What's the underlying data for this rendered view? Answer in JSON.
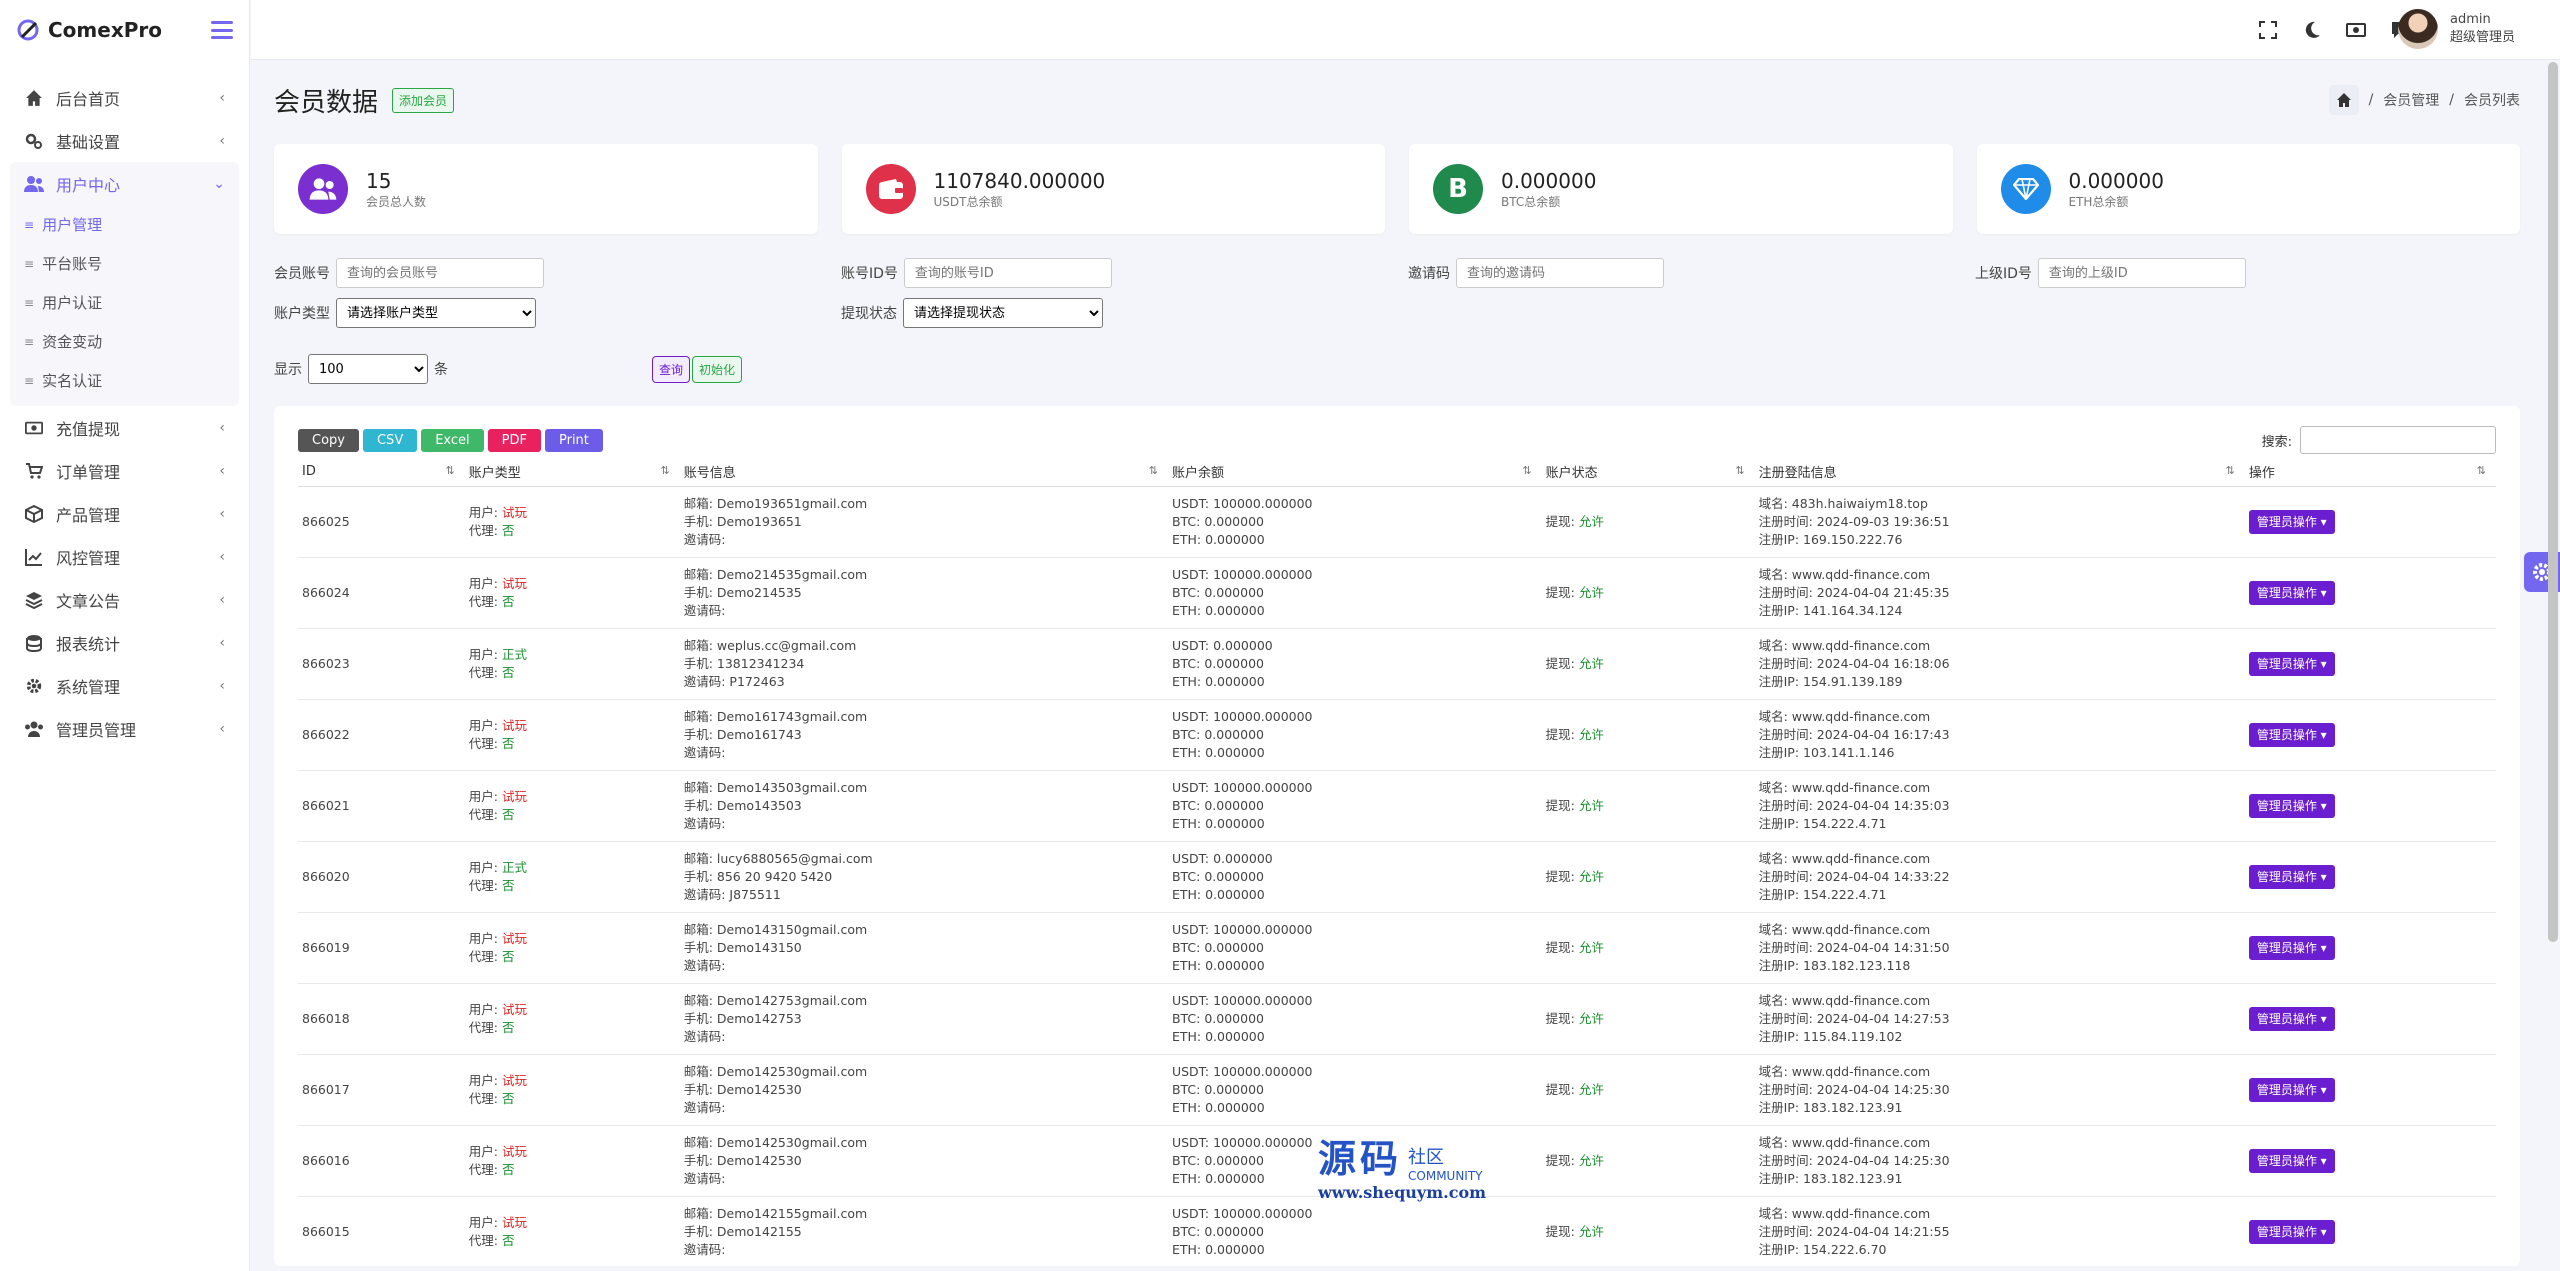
{
  "app": {
    "brand": "ComexPro"
  },
  "sidebar": {
    "items": [
      {
        "label": "后台首页",
        "icon": "home-icon"
      },
      {
        "label": "基础设置",
        "icon": "gears-icon"
      }
    ],
    "active_group": {
      "label": "用户中心",
      "icon": "users-icon",
      "children": [
        "用户管理",
        "平台账号",
        "用户认证",
        "资金变动",
        "实名认证"
      ],
      "active_child": "用户管理"
    },
    "items_after": [
      {
        "label": "充值提现",
        "icon": "money-icon"
      },
      {
        "label": "订单管理",
        "icon": "cart-icon"
      },
      {
        "label": "产品管理",
        "icon": "box-icon"
      },
      {
        "label": "风控管理",
        "icon": "chart-line-icon"
      },
      {
        "label": "文章公告",
        "icon": "layers-icon"
      },
      {
        "label": "报表统计",
        "icon": "database-icon"
      },
      {
        "label": "系统管理",
        "icon": "gear-icon"
      },
      {
        "label": "管理员管理",
        "icon": "user-group-icon"
      }
    ]
  },
  "topbar": {
    "username": "admin",
    "role": "超级管理员"
  },
  "page": {
    "title": "会员数据",
    "add_button": "添加会员",
    "breadcrumb": [
      "会员管理",
      "会员列表"
    ]
  },
  "stats": [
    {
      "value": "15",
      "label": "会员总人数",
      "color": "#7b2fd1",
      "icon": "users-icon"
    },
    {
      "value": "1107840.000000",
      "label": "USDT总余额",
      "color": "#e0314b",
      "icon": "wallet-icon"
    },
    {
      "value": "0.000000",
      "label": "BTC总余额",
      "color": "#1f8a4c",
      "icon": "btc-icon",
      "glyph": "B"
    },
    {
      "value": "0.000000",
      "label": "ETH总余额",
      "color": "#1e8ce8",
      "icon": "diamond-icon"
    }
  ],
  "filters": {
    "account": {
      "label": "会员账号",
      "placeholder": "查询的会员账号"
    },
    "account_id": {
      "label": "账号ID号",
      "placeholder": "查询的账号ID"
    },
    "invite": {
      "label": "邀请码",
      "placeholder": "查询的邀请码"
    },
    "parent_id": {
      "label": "上级ID号",
      "placeholder": "查询的上级ID"
    },
    "account_type": {
      "label": "账户类型",
      "selected": "请选择账户类型"
    },
    "withdraw_status": {
      "label": "提现状态",
      "selected": "请选择提现状态"
    },
    "show_label": "显示",
    "show_value": "100",
    "show_unit": "条",
    "query_button": "查询",
    "reset_button": "初始化"
  },
  "table": {
    "export_buttons": [
      {
        "label": "Copy",
        "color": "#555555"
      },
      {
        "label": "CSV",
        "color": "#2fb6d0"
      },
      {
        "label": "Excel",
        "color": "#3fb86a"
      },
      {
        "label": "PDF",
        "color": "#e8225e"
      },
      {
        "label": "Print",
        "color": "#6c5ce7"
      }
    ],
    "search_label": "搜索:",
    "headers": [
      "ID",
      "账户类型",
      "账号信息",
      "账户余额",
      "账户状态",
      "注册登陆信息",
      "操作"
    ],
    "prefix": {
      "user": "用户: ",
      "agent": "代理: ",
      "email": "邮箱: ",
      "phone": "手机: ",
      "invite": "邀请码: ",
      "usdt": "USDT: ",
      "btc": "BTC: ",
      "eth": "ETH: ",
      "withdraw": "提现: ",
      "domain": "域名: ",
      "reg_time": "注册时间: ",
      "reg_ip": "注册IP: "
    },
    "action_label": "管理员操作",
    "rows": [
      {
        "id": "866025",
        "user_type": "试玩",
        "agent": "否",
        "email": "Demo193651gmail.com",
        "phone": "Demo193651",
        "invite": "",
        "usdt": "100000.000000",
        "btc": "0.000000",
        "eth": "0.000000",
        "withdraw": "允许",
        "domain": "483h.haiwaiym18.top",
        "reg_time": "2024-09-03 19:36:51",
        "reg_ip": "169.150.222.76"
      },
      {
        "id": "866024",
        "user_type": "试玩",
        "agent": "否",
        "email": "Demo214535gmail.com",
        "phone": "Demo214535",
        "invite": "",
        "usdt": "100000.000000",
        "btc": "0.000000",
        "eth": "0.000000",
        "withdraw": "允许",
        "domain": "www.qdd-finance.com",
        "reg_time": "2024-04-04 21:45:35",
        "reg_ip": "141.164.34.124"
      },
      {
        "id": "866023",
        "user_type": "正式",
        "agent": "否",
        "email": "weplus.cc@gmail.com",
        "phone": "13812341234",
        "invite": "P172463",
        "usdt": "0.000000",
        "btc": "0.000000",
        "eth": "0.000000",
        "withdraw": "允许",
        "domain": "www.qdd-finance.com",
        "reg_time": "2024-04-04 16:18:06",
        "reg_ip": "154.91.139.189"
      },
      {
        "id": "866022",
        "user_type": "试玩",
        "agent": "否",
        "email": "Demo161743gmail.com",
        "phone": "Demo161743",
        "invite": "",
        "usdt": "100000.000000",
        "btc": "0.000000",
        "eth": "0.000000",
        "withdraw": "允许",
        "domain": "www.qdd-finance.com",
        "reg_time": "2024-04-04 16:17:43",
        "reg_ip": "103.141.1.146"
      },
      {
        "id": "866021",
        "user_type": "试玩",
        "agent": "否",
        "email": "Demo143503gmail.com",
        "phone": "Demo143503",
        "invite": "",
        "usdt": "100000.000000",
        "btc": "0.000000",
        "eth": "0.000000",
        "withdraw": "允许",
        "domain": "www.qdd-finance.com",
        "reg_time": "2024-04-04 14:35:03",
        "reg_ip": "154.222.4.71"
      },
      {
        "id": "866020",
        "user_type": "正式",
        "agent": "否",
        "email": "lucy6880565@gmai.com",
        "phone": "856 20 9420 5420",
        "invite": "J875511",
        "usdt": "0.000000",
        "btc": "0.000000",
        "eth": "0.000000",
        "withdraw": "允许",
        "domain": "www.qdd-finance.com",
        "reg_time": "2024-04-04 14:33:22",
        "reg_ip": "154.222.4.71"
      },
      {
        "id": "866019",
        "user_type": "试玩",
        "agent": "否",
        "email": "Demo143150gmail.com",
        "phone": "Demo143150",
        "invite": "",
        "usdt": "100000.000000",
        "btc": "0.000000",
        "eth": "0.000000",
        "withdraw": "允许",
        "domain": "www.qdd-finance.com",
        "reg_time": "2024-04-04 14:31:50",
        "reg_ip": "183.182.123.118"
      },
      {
        "id": "866018",
        "user_type": "试玩",
        "agent": "否",
        "email": "Demo142753gmail.com",
        "phone": "Demo142753",
        "invite": "",
        "usdt": "100000.000000",
        "btc": "0.000000",
        "eth": "0.000000",
        "withdraw": "允许",
        "domain": "www.qdd-finance.com",
        "reg_time": "2024-04-04 14:27:53",
        "reg_ip": "115.84.119.102"
      },
      {
        "id": "866017",
        "user_type": "试玩",
        "agent": "否",
        "email": "Demo142530gmail.com",
        "phone": "Demo142530",
        "invite": "",
        "usdt": "100000.000000",
        "btc": "0.000000",
        "eth": "0.000000",
        "withdraw": "允许",
        "domain": "www.qdd-finance.com",
        "reg_time": "2024-04-04 14:25:30",
        "reg_ip": "183.182.123.91"
      },
      {
        "id": "866016",
        "user_type": "试玩",
        "agent": "否",
        "email": "Demo142530gmail.com",
        "phone": "Demo142530",
        "invite": "",
        "usdt": "100000.000000",
        "btc": "0.000000",
        "eth": "0.000000",
        "withdraw": "允许",
        "domain": "www.qdd-finance.com",
        "reg_time": "2024-04-04 14:25:30",
        "reg_ip": "183.182.123.91"
      },
      {
        "id": "866015",
        "user_type": "试玩",
        "agent": "否",
        "email": "Demo142155gmail.com",
        "phone": "Demo142155",
        "invite": "",
        "usdt": "100000.000000",
        "btc": "0.000000",
        "eth": "0.000000",
        "withdraw": "允许",
        "domain": "www.qdd-finance.com",
        "reg_time": "2024-04-04 14:21:55",
        "reg_ip": "154.222.6.70"
      }
    ]
  },
  "watermark": {
    "big": "源码",
    "small": "社区",
    "community": "COMMUNITY",
    "url": "www.shequym.com"
  }
}
